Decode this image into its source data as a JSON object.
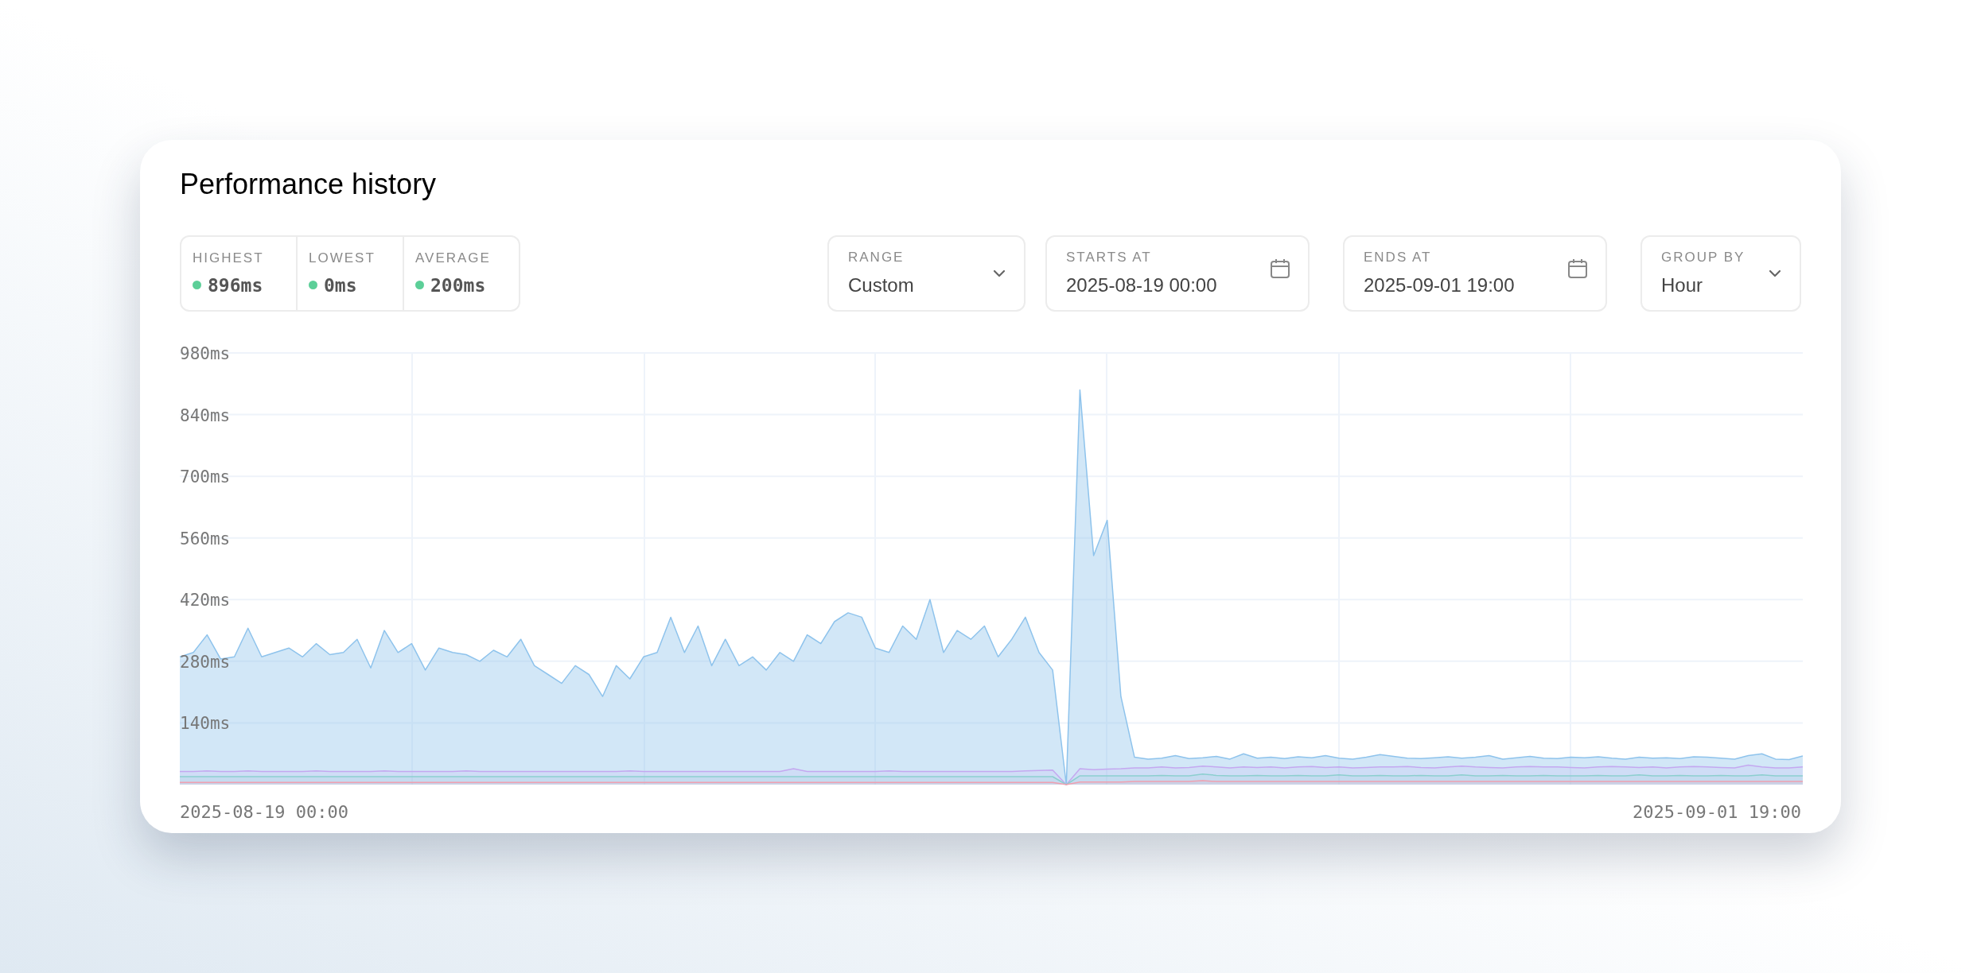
{
  "card": {
    "title": "Performance history"
  },
  "stats": [
    {
      "label": "HIGHEST",
      "value": "896ms"
    },
    {
      "label": "LOWEST",
      "value": "0ms"
    },
    {
      "label": "AVERAGE",
      "value": "200ms"
    }
  ],
  "controls": [
    {
      "kind": "select",
      "label": "RANGE",
      "value": "Custom"
    },
    {
      "kind": "date",
      "label": "STARTS AT",
      "value": "2025-08-19 00:00"
    },
    {
      "kind": "date",
      "label": "ENDS AT",
      "value": "2025-09-01 19:00"
    },
    {
      "kind": "select",
      "label": "GROUP BY",
      "value": "Hour"
    }
  ],
  "x_axis_labels": [
    "2025-08-19 00:00",
    "2025-09-01 19:00"
  ],
  "chart_data": {
    "type": "area",
    "grid": true,
    "ylim": [
      0,
      980
    ],
    "yticks": [
      {
        "value": 140,
        "label": "140ms"
      },
      {
        "value": 280,
        "label": "280ms"
      },
      {
        "value": 420,
        "label": "420ms"
      },
      {
        "value": 560,
        "label": "560ms"
      },
      {
        "value": 700,
        "label": "700ms"
      },
      {
        "value": 840,
        "label": "840ms"
      },
      {
        "value": 980,
        "label": "980ms"
      }
    ],
    "series": [
      {
        "color": "#8ec3ec",
        "values": [
          290,
          300,
          340,
          285,
          290,
          355,
          290,
          300,
          310,
          290,
          320,
          295,
          300,
          330,
          265,
          350,
          300,
          320,
          260,
          310,
          300,
          295,
          280,
          305,
          290,
          330,
          270,
          250,
          230,
          270,
          250,
          200,
          270,
          240,
          290,
          300,
          380,
          300,
          360,
          270,
          330,
          270,
          290,
          260,
          300,
          280,
          340,
          320,
          370,
          390,
          380,
          310,
          300,
          360,
          330,
          420,
          300,
          350,
          330,
          360,
          290,
          330,
          380,
          300,
          260,
          0,
          896,
          520,
          600,
          200,
          62,
          58,
          60,
          66,
          59,
          61,
          64,
          58,
          70,
          60,
          62,
          59,
          63,
          61,
          66,
          60,
          58,
          62,
          68,
          64,
          60,
          59,
          61,
          63,
          60,
          62,
          66,
          58,
          61,
          64,
          60,
          59,
          62,
          61,
          63,
          60,
          58,
          62,
          60,
          61,
          59,
          63,
          62,
          60,
          58,
          66,
          70,
          58,
          57,
          65
        ]
      },
      {
        "color": "#c4a8f0",
        "values": [
          30,
          30,
          31,
          30,
          30,
          31,
          30,
          30,
          30,
          30,
          31,
          30,
          30,
          30,
          30,
          31,
          30,
          30,
          30,
          30,
          30,
          31,
          30,
          30,
          30,
          30,
          30,
          30,
          30,
          30,
          30,
          30,
          30,
          31,
          30,
          30,
          30,
          30,
          30,
          30,
          30,
          30,
          30,
          30,
          30,
          36,
          30,
          30,
          30,
          30,
          30,
          30,
          31,
          30,
          30,
          30,
          30,
          30,
          30,
          30,
          30,
          30,
          31,
          32,
          33,
          0,
          36,
          34,
          35,
          36,
          38,
          38,
          40,
          38,
          39,
          42,
          40,
          38,
          40,
          39,
          40,
          38,
          40,
          41,
          39,
          40,
          38,
          39,
          40,
          40,
          41,
          39,
          38,
          40,
          42,
          40,
          39,
          38,
          40,
          41,
          40,
          40,
          39,
          38,
          40,
          41,
          40,
          39,
          40,
          38,
          40,
          41,
          40,
          39,
          38,
          44,
          40,
          38,
          38,
          40
        ]
      },
      {
        "color": "#8ccfcf",
        "values": [
          18,
          18,
          18,
          18,
          18,
          18,
          18,
          18,
          18,
          18,
          18,
          18,
          18,
          18,
          18,
          18,
          18,
          18,
          18,
          18,
          18,
          18,
          18,
          18,
          18,
          18,
          18,
          18,
          18,
          18,
          18,
          18,
          18,
          18,
          18,
          18,
          18,
          18,
          18,
          18,
          18,
          18,
          18,
          18,
          18,
          18,
          18,
          18,
          18,
          18,
          18,
          18,
          18,
          18,
          18,
          18,
          18,
          18,
          18,
          18,
          18,
          18,
          18,
          18,
          18,
          0,
          20,
          20,
          20,
          20,
          20,
          20,
          21,
          20,
          20,
          24,
          21,
          20,
          20,
          21,
          20,
          20,
          21,
          20,
          20,
          22,
          20,
          20,
          21,
          20,
          20,
          21,
          20,
          20,
          22,
          20,
          20,
          21,
          20,
          20,
          21,
          20,
          20,
          20,
          21,
          20,
          20,
          22,
          20,
          20,
          21,
          20,
          20,
          21,
          20,
          20,
          22,
          20,
          20,
          20
        ]
      },
      {
        "color": "#f0a0b0",
        "values": [
          5,
          5,
          5,
          5,
          5,
          5,
          5,
          5,
          5,
          5,
          5,
          5,
          5,
          5,
          5,
          5,
          5,
          5,
          5,
          5,
          5,
          5,
          5,
          5,
          5,
          5,
          5,
          5,
          5,
          5,
          5,
          5,
          5,
          5,
          5,
          5,
          5,
          5,
          5,
          5,
          5,
          5,
          5,
          5,
          5,
          5,
          5,
          5,
          5,
          5,
          5,
          5,
          5,
          5,
          5,
          5,
          5,
          5,
          5,
          5,
          5,
          5,
          5,
          5,
          5,
          0,
          6,
          6,
          6,
          6,
          7,
          7,
          7,
          7,
          7,
          9,
          7,
          7,
          7,
          7,
          7,
          7,
          7,
          7,
          7,
          7,
          7,
          7,
          7,
          7,
          7,
          7,
          7,
          7,
          7,
          7,
          7,
          7,
          7,
          7,
          7,
          7,
          7,
          7,
          7,
          7,
          7,
          7,
          7,
          7,
          7,
          7,
          7,
          7,
          7,
          7,
          7,
          7,
          7,
          7
        ]
      }
    ]
  }
}
